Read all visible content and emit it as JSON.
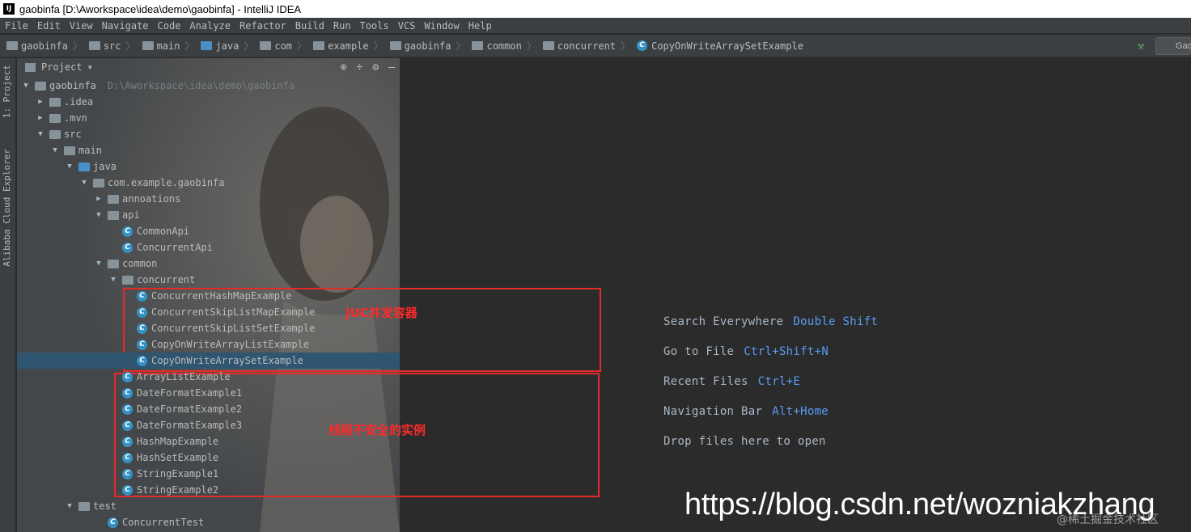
{
  "window": {
    "title": "gaobinfa [D:\\Aworkspace\\idea\\demo\\gaobinfa] - IntelliJ IDEA",
    "logo": "IJ"
  },
  "menu": [
    "File",
    "Edit",
    "View",
    "Navigate",
    "Code",
    "Analyze",
    "Refactor",
    "Build",
    "Run",
    "Tools",
    "VCS",
    "Window",
    "Help"
  ],
  "breadcrumbs": [
    "gaobinfa",
    "src",
    "main",
    "java",
    "com",
    "example",
    "gaobinfa",
    "common",
    "concurrent",
    "CopyOnWriteArraySetExample"
  ],
  "run_config": "Gao",
  "side_tabs": {
    "project": "1: Project",
    "cloud": "Alibaba Cloud Explorer"
  },
  "panel": {
    "title": "Project",
    "dropdown": "▾",
    "locate": "⊕",
    "collapse": "÷",
    "gear": "⚙",
    "hide": "—"
  },
  "tree": [
    {
      "label": "gaobinfa",
      "hint": "D:\\Aworkspace\\idea\\demo\\gaobinfa",
      "arrow": "▼",
      "icon": "folder"
    },
    {
      "label": ".idea",
      "arrow": "▶",
      "icon": "folder"
    },
    {
      "label": ".mvn",
      "arrow": "▶",
      "icon": "folder"
    },
    {
      "label": "src",
      "arrow": "▼",
      "icon": "folder"
    },
    {
      "label": "main",
      "arrow": "▼",
      "icon": "folder"
    },
    {
      "label": "java",
      "arrow": "▼",
      "icon": "folder-blue"
    },
    {
      "label": "com.example.gaobinfa",
      "arrow": "▼",
      "icon": "package"
    },
    {
      "label": "annoations",
      "arrow": "▶",
      "icon": "package"
    },
    {
      "label": "api",
      "arrow": "▼",
      "icon": "package"
    },
    {
      "label": "CommonApi",
      "arrow": "",
      "icon": "class"
    },
    {
      "label": "ConcurrentApi",
      "arrow": "",
      "icon": "class"
    },
    {
      "label": "common",
      "arrow": "▼",
      "icon": "package"
    },
    {
      "label": "concurrent",
      "arrow": "▼",
      "icon": "package"
    },
    {
      "label": "ConcurrentHashMapExample",
      "arrow": "",
      "icon": "class"
    },
    {
      "label": "ConcurrentSkipListMapExample",
      "arrow": "",
      "icon": "class"
    },
    {
      "label": "ConcurrentSkipListSetExample",
      "arrow": "",
      "icon": "class"
    },
    {
      "label": "CopyOnWriteArrayListExample",
      "arrow": "",
      "icon": "class"
    },
    {
      "label": "CopyOnWriteArraySetExample",
      "arrow": "",
      "icon": "class"
    },
    {
      "label": "ArrayListExample",
      "arrow": "",
      "icon": "class"
    },
    {
      "label": "DateFormatExample1",
      "arrow": "",
      "icon": "class"
    },
    {
      "label": "DateFormatExample2",
      "arrow": "",
      "icon": "class"
    },
    {
      "label": "DateFormatExample3",
      "arrow": "",
      "icon": "class"
    },
    {
      "label": "HashMapExample",
      "arrow": "",
      "icon": "class"
    },
    {
      "label": "HashSetExample",
      "arrow": "",
      "icon": "class"
    },
    {
      "label": "StringExample1",
      "arrow": "",
      "icon": "class"
    },
    {
      "label": "StringExample2",
      "arrow": "",
      "icon": "class"
    },
    {
      "label": "test",
      "arrow": "▼",
      "icon": "package"
    },
    {
      "label": "ConcurrentTest",
      "arrow": "",
      "icon": "class"
    }
  ],
  "editor_hints": [
    {
      "text": "Search Everywhere",
      "key": "Double Shift"
    },
    {
      "text": "Go to File",
      "key": "Ctrl+Shift+N"
    },
    {
      "text": "Recent Files",
      "key": "Ctrl+E"
    },
    {
      "text": "Navigation Bar",
      "key": "Alt+Home"
    },
    {
      "text": "Drop files here to open",
      "key": ""
    }
  ],
  "annotations": {
    "juc": "JUC并发容器",
    "unsafe": "线程不安全的实例"
  },
  "watermark": "https://blog.csdn.net/wozniakzhang",
  "watermark2": "@稀土掘金技术社区",
  "colors": {
    "accent": "#589df6",
    "selection": "#2f5571",
    "annotation": "#e52a2a"
  }
}
